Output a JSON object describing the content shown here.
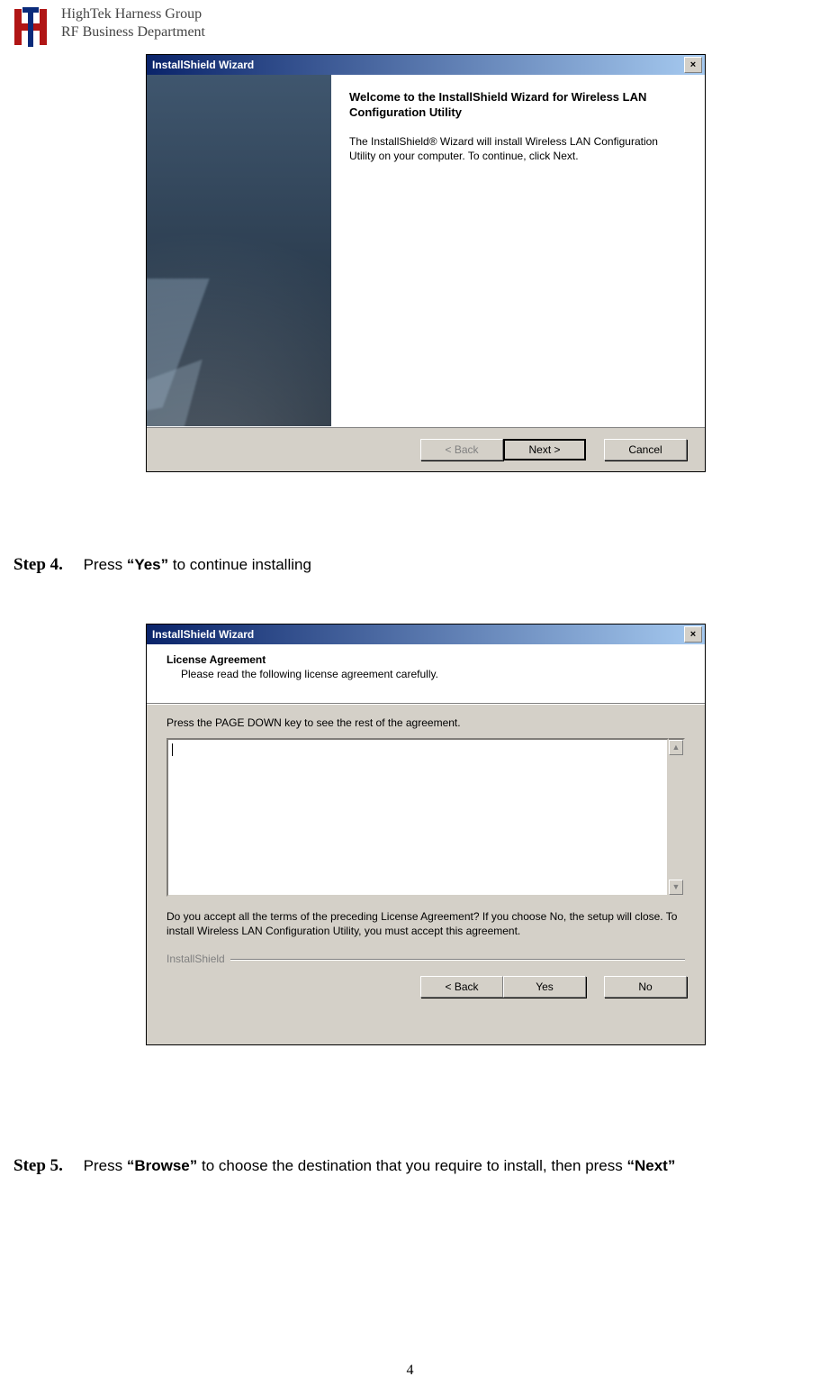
{
  "header": {
    "line1": "HighTek Harness Group",
    "line2": "RF Business Department"
  },
  "wizard1": {
    "title": "InstallShield Wizard",
    "close_label": "×",
    "heading": "Welcome to the InstallShield Wizard for Wireless LAN Configuration Utility",
    "body": "The InstallShield® Wizard will install Wireless LAN Configuration Utility on your computer.  To continue, click Next.",
    "back": "< Back",
    "next": "Next >",
    "cancel": "Cancel"
  },
  "step4": {
    "label": "Step 4.",
    "pre": "Press ",
    "q1": "“",
    "bold": "Yes",
    "q2": "”",
    "post": " to continue installing"
  },
  "wizard2": {
    "title": "InstallShield Wizard",
    "close_label": "×",
    "htitle": "License Agreement",
    "hsub": "Please read the following license agreement carefully.",
    "instr": "Press the PAGE DOWN key to see the rest of the agreement.",
    "accept": "Do you accept all the terms of the preceding License Agreement?  If you choose No,  the setup will close.  To install Wireless LAN Configuration Utility, you must accept this agreement.",
    "group": "InstallShield",
    "scroll_up": "▲",
    "scroll_down": "▼",
    "back": "< Back",
    "yes": "Yes",
    "no": "No"
  },
  "step5": {
    "label": "Step 5.",
    "pre": "Press ",
    "q1": "“",
    "bold1": "Browse",
    "q2": "”",
    "mid": " to choose the destination that you require to install, then press ",
    "q3": "“",
    "bold2": "Next",
    "q4": "”"
  },
  "page_number": "4"
}
